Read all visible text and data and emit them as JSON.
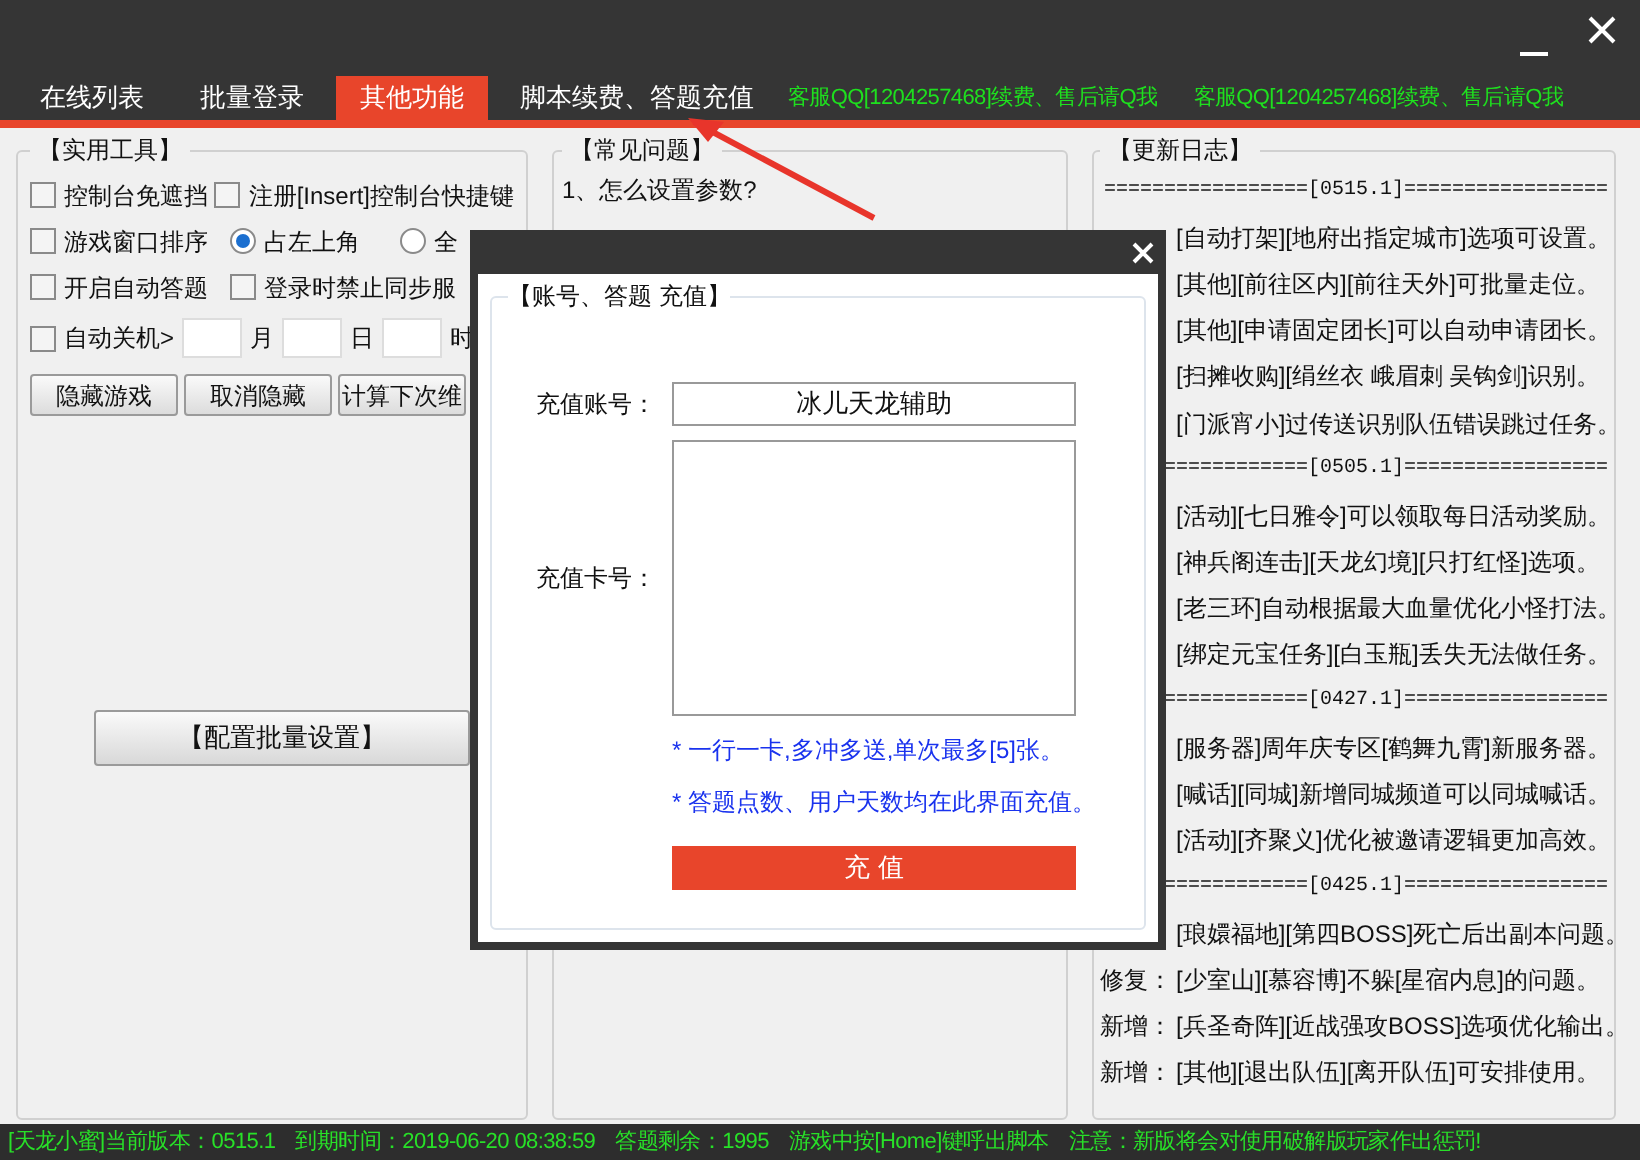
{
  "tabs": [
    {
      "label": "在线列表",
      "selected": false
    },
    {
      "label": "批量登录",
      "selected": false
    },
    {
      "label": "其他功能",
      "selected": true
    },
    {
      "label": "脚本续费、答题充值",
      "selected": false
    }
  ],
  "marquee": [
    "客服QQ[1204257468]续费、售后请Q我",
    "客服QQ[1204257468]续费、售后请Q我"
  ],
  "tools": {
    "title": "【实用工具】",
    "rows": [
      [
        {
          "kind": "checkbox",
          "label": "控制台免遮挡",
          "checked": false
        },
        {
          "kind": "checkbox",
          "label": "注册[Insert]控制台快捷键",
          "checked": false
        }
      ],
      [
        {
          "kind": "checkbox",
          "label": "游戏窗口排序",
          "checked": false
        },
        {
          "kind": "radio",
          "label": "占左上角",
          "selected": true
        },
        {
          "kind": "radio",
          "label": "全",
          "selected": false
        }
      ],
      [
        {
          "kind": "checkbox",
          "label": "开启自动答题",
          "checked": false
        },
        {
          "kind": "checkbox",
          "label": "登录时禁止同步服",
          "checked": false
        }
      ]
    ],
    "shutdown": {
      "label": "自动关机>",
      "checked": false,
      "units": [
        "月",
        "日",
        "时"
      ]
    },
    "buttons": [
      "隐藏游戏",
      "取消隐藏",
      "计算下次维"
    ],
    "config_button": "【配置批量设置】"
  },
  "faq": {
    "title": "【常见问题】",
    "items": [
      "1、怎么设置参数?"
    ]
  },
  "changelog": {
    "title": "【更新日志】",
    "lines": [
      {
        "kind": "separator",
        "text": "=================[0515.1]================="
      },
      {
        "kind": "entry",
        "text": "[自动打架][地府出指定城市]选项可设置。"
      },
      {
        "kind": "entry",
        "text": "[其他][前往区内][前往天外]可批量走位。"
      },
      {
        "kind": "entry",
        "text": "[其他][申请固定团长]可以自动申请团长。"
      },
      {
        "kind": "entry",
        "text": "[扫摊收购][绢丝衣 峨眉刺 吴钩剑]识别。"
      },
      {
        "kind": "entry",
        "text": "[门派宵小]过传送识别队伍错误跳过任务。"
      },
      {
        "kind": "separator",
        "text": "============[0505.1]================="
      },
      {
        "kind": "entry",
        "text": "[活动][七日雅令]可以领取每日活动奖励。"
      },
      {
        "kind": "entry",
        "text": "[神兵阁连击][天龙幻境][只打红怪]选项。"
      },
      {
        "kind": "entry",
        "text": "[老三环]自动根据最大血量优化小怪打法。"
      },
      {
        "kind": "entry",
        "text": "[绑定元宝任务][白玉瓶]丢失无法做任务。"
      },
      {
        "kind": "separator",
        "text": "============[0427.1]================="
      },
      {
        "kind": "entry",
        "text": "[服务器]周年庆专区[鹤舞九霄]新服务器。"
      },
      {
        "kind": "entry",
        "text": "[喊话][同城]新增同城频道可以同城喊话。"
      },
      {
        "kind": "entry",
        "text": "[活动][齐聚义]优化被邀请逻辑更加高效。"
      },
      {
        "kind": "separator",
        "text": "============[0425.1]================="
      },
      {
        "kind": "entry",
        "text": "[琅嬛福地][第四BOSS]死亡后出副本问题。"
      },
      {
        "kind": "entry",
        "prefix": "修复：",
        "text": "[少室山][慕容博]不躲[星宿内息]的问题。"
      },
      {
        "kind": "entry",
        "prefix": "新增：",
        "text": "[兵圣奇阵][近战强攻BOSS]选项优化输出。"
      },
      {
        "kind": "entry",
        "prefix": "新增：",
        "text": "[其他][退出队伍][离开队伍]可安排使用。"
      }
    ]
  },
  "dialog": {
    "group_title": "【账号、答题 充值】",
    "account": {
      "label": "充值账号：",
      "value": "冰儿天龙辅助"
    },
    "card": {
      "label": "充值卡号："
    },
    "notes": [
      "* 一行一卡,多冲多送,单次最多[5]张。",
      "* 答题点数、用户天数均在此界面充值。"
    ],
    "submit": "充 值"
  },
  "status": [
    "[天龙小蜜]当前版本：0515.1",
    "到期时间：2019-06-20 08:38:59",
    "答题剩余：1995",
    "游戏中按[Home]键呼出脚本",
    "注意：新版将会对使用破解版玩家作出惩罚!"
  ]
}
